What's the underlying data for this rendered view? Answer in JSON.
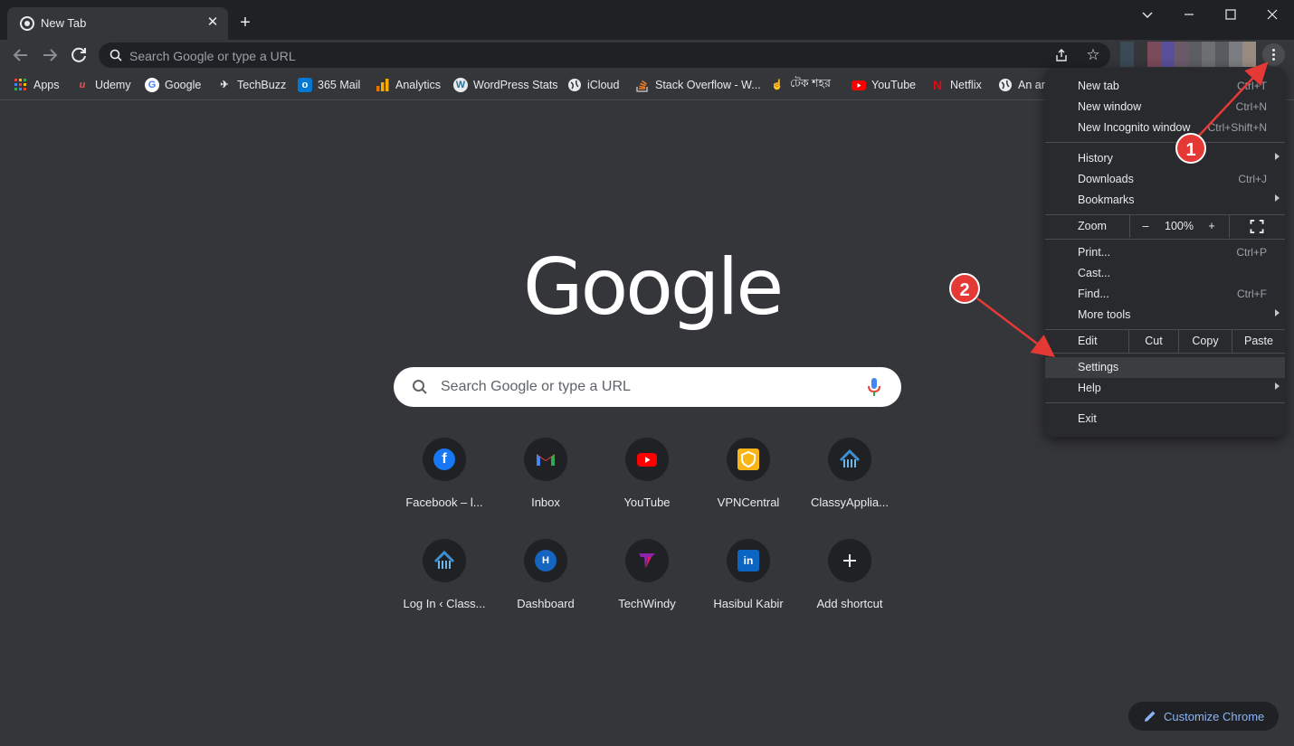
{
  "tab": {
    "title": "New Tab"
  },
  "window_controls": {
    "minimize": "⌵",
    "maximize": "☐",
    "close": "✕"
  },
  "omnibox": {
    "placeholder": "Search Google or type a URL"
  },
  "bookmarks": [
    {
      "label": "Apps",
      "icon": "apps-grid-icon"
    },
    {
      "label": "Udemy",
      "icon": "udemy-icon"
    },
    {
      "label": "Google",
      "icon": "google-icon"
    },
    {
      "label": "TechBuzz",
      "icon": "techbuzz-icon"
    },
    {
      "label": "365 Mail",
      "icon": "outlook-icon"
    },
    {
      "label": "Analytics",
      "icon": "analytics-icon"
    },
    {
      "label": "WordPress Stats",
      "icon": "wordpress-icon"
    },
    {
      "label": "iCloud",
      "icon": "globe-icon"
    },
    {
      "label": "Stack Overflow - W...",
      "icon": "stackoverflow-icon"
    },
    {
      "label": "টেক শহর",
      "icon": "tech-shohor-icon"
    },
    {
      "label": "YouTube",
      "icon": "youtube-icon"
    },
    {
      "label": "Netflix",
      "icon": "netflix-icon"
    },
    {
      "label": "An ar",
      "icon": "globe-icon"
    }
  ],
  "logo": {
    "text": "Google"
  },
  "search": {
    "placeholder": "Search Google or type a URL"
  },
  "shortcuts": [
    {
      "label": "Facebook – l...",
      "icon": "facebook-icon",
      "color": "#1877f2"
    },
    {
      "label": "Inbox",
      "icon": "gmail-icon",
      "color": "#ea4335"
    },
    {
      "label": "YouTube",
      "icon": "youtube-icon",
      "color": "#ff0000"
    },
    {
      "label": "VPNCentral",
      "icon": "vpncentral-icon",
      "color": "#f9b515"
    },
    {
      "label": "ClassyApplia...",
      "icon": "classy-house-icon",
      "color": "#3d8fd1"
    },
    {
      "label": "Log In ‹ Class...",
      "icon": "classy-house-icon",
      "color": "#3d8fd1"
    },
    {
      "label": "Dashboard",
      "icon": "dashboard-h-icon",
      "color": "#1565c0"
    },
    {
      "label": "TechWindy",
      "icon": "techwindy-icon",
      "color": "#8e24aa"
    },
    {
      "label": "Hasibul Kabir",
      "icon": "linkedin-icon",
      "color": "#0a66c2"
    },
    {
      "label": "Add shortcut",
      "icon": "plus-icon",
      "color": "#202124"
    }
  ],
  "customize": {
    "label": "Customize Chrome"
  },
  "menu": {
    "new_tab": {
      "label": "New tab",
      "shortcut": "Ctrl+T"
    },
    "new_window": {
      "label": "New window",
      "shortcut": "Ctrl+N"
    },
    "new_incognito": {
      "label": "New Incognito window",
      "shortcut": "Ctrl+Shift+N"
    },
    "history": {
      "label": "History"
    },
    "downloads": {
      "label": "Downloads",
      "shortcut": "Ctrl+J"
    },
    "bookmarks": {
      "label": "Bookmarks"
    },
    "zoom": {
      "label": "Zoom",
      "minus": "–",
      "value": "100%",
      "plus": "+"
    },
    "print": {
      "label": "Print...",
      "shortcut": "Ctrl+P"
    },
    "cast": {
      "label": "Cast..."
    },
    "find": {
      "label": "Find...",
      "shortcut": "Ctrl+F"
    },
    "more_tools": {
      "label": "More tools"
    },
    "edit": {
      "label": "Edit",
      "cut": "Cut",
      "copy": "Copy",
      "paste": "Paste"
    },
    "settings": {
      "label": "Settings"
    },
    "help": {
      "label": "Help"
    },
    "exit": {
      "label": "Exit"
    }
  },
  "annotations": {
    "step1": "1",
    "step2": "2",
    "color": "#e53935"
  }
}
